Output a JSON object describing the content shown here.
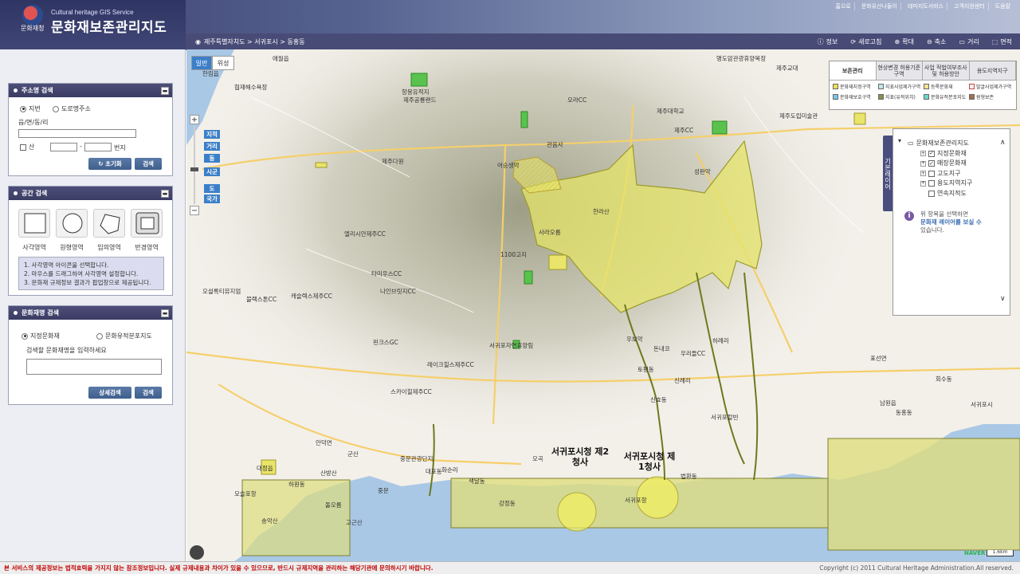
{
  "header": {
    "agency": "문화재청",
    "eng_title": "Cultural heritage GIS Service",
    "title": "문화재보존관리지도",
    "top_links": [
      "홈으로",
      "문화유산나들이",
      "테마지도서비스",
      "고객지원센터",
      "도움말"
    ]
  },
  "toolbar": {
    "breadcrumb": "제주특별자치도 > 서귀포시 > 동홍동",
    "tools": [
      {
        "label": "정보",
        "icon": "info-icon"
      },
      {
        "label": "새로고침",
        "icon": "refresh-icon"
      },
      {
        "label": "확대",
        "icon": "zoom-in-icon"
      },
      {
        "label": "축소",
        "icon": "zoom-out-icon"
      },
      {
        "label": "거리",
        "icon": "ruler-icon"
      },
      {
        "label": "면적",
        "icon": "area-icon"
      }
    ]
  },
  "address_search": {
    "title": "주소명 검색",
    "option_jibun": "지번",
    "option_road": "도로명주소",
    "field_label": "읍/면/동/리",
    "mountain_label": "산",
    "dash": "-",
    "bunji_label": "번지",
    "reset_label": "초기화",
    "search_label": "검색"
  },
  "spatial_search": {
    "title": "공간 검색",
    "shapes": [
      "사각영역",
      "원형영역",
      "임의영역",
      "반경영역"
    ],
    "instructions": [
      "1. 사각영역 아이콘을 선택합니다.",
      "2. 마우스를 드래그하여 사각영역 설정합니다.",
      "3. 문화재 규제정보 결과가 팝업창으로 제공됩니다."
    ]
  },
  "heritage_search": {
    "title": "문화재명 검색",
    "option_designated": "지정문화재",
    "option_site": "문화유적분포지도",
    "prompt": "검색할 문화재명을 입력하세요",
    "detail_label": "상세검색",
    "search_label": "검색"
  },
  "map": {
    "type_general": "일반",
    "type_satellite": "위성",
    "zoom_levels": [
      "지적",
      "거리",
      "동",
      "시군",
      "도",
      "국가"
    ],
    "big_labels": [
      {
        "text": "서귀포시청 제2청사"
      },
      {
        "text": "서귀포시청 제1청사"
      }
    ],
    "labels": [
      "애월읍",
      "항몽유적지",
      "제주공룡랜드",
      "한림읍",
      "협재해수욕장",
      "제주다원",
      "명도암관광휴양목장",
      "제주대학교",
      "제주CC",
      "오라CC",
      "제주교대",
      "제주도립미술관",
      "한라산",
      "사라오름",
      "1100고지",
      "관음사",
      "성판악",
      "어승생악",
      "오설록티뮤지엄",
      "엘리시안제주CC",
      "타미우스CC",
      "나인브릿지CC",
      "캐슬렉스제주CC",
      "블랙스톤CC",
      "핀크스GC",
      "레이크힐스제주CC",
      "스카이힐제주CC",
      "서귀포자연휴양림",
      "중문관광단지",
      "대포동",
      "강정동",
      "법환동",
      "서귀포항",
      "남원읍",
      "표선면",
      "안덕면",
      "대정읍",
      "모슬포항",
      "송악산",
      "산방산",
      "군산",
      "하례리",
      "우리들CC",
      "우보악",
      "돈내코",
      "서귀포칼빈",
      "서귀포시",
      "동홍동",
      "토평동",
      "신례리",
      "신효동",
      "돌오름",
      "오곡",
      "화순리",
      "고근산",
      "중문",
      "색달동",
      "하원동",
      "회수동"
    ],
    "legend": {
      "tabs": [
        "보존관리",
        "현상변경 허용기준구역",
        "사업 적법여부조사 및 허용방안",
        "용도지역지구"
      ],
      "items": [
        {
          "label": "문화재지정구역",
          "color": "#f2e050"
        },
        {
          "label": "지표사업제가구역",
          "color": "#bfe8e8"
        },
        {
          "label": "등록문화재",
          "color": "#f7e38c"
        },
        {
          "label": "발굴사업제가구역",
          "color": "#f2f2f2"
        },
        {
          "label": "문화재보호구역",
          "color": "#79c5f0"
        },
        {
          "label": "지표(유적위치)",
          "color": "#8a8f52"
        },
        {
          "label": "문화유적분포지도",
          "color": "#6ad8c9"
        },
        {
          "label": "원형보존",
          "color": "#a37050"
        }
      ]
    },
    "layers": {
      "tab_label": "기본레이어",
      "root": "문화재보존관리지도",
      "items": [
        {
          "label": "지정문화재",
          "checked": true
        },
        {
          "label": "매장문화재",
          "checked": true
        },
        {
          "label": "고도지구",
          "checked": false
        },
        {
          "label": "용도지역지구",
          "checked": false
        },
        {
          "label": "연속지적도",
          "checked": false
        }
      ],
      "hint_line1": "위 항목을 선택하면",
      "hint_line2": "문화재 레이어를 보실 수",
      "hint_line3": "있습니다."
    },
    "naver": "NAVER",
    "scale": "1.6km"
  },
  "footer": {
    "warning": "본 서비스의 제공정보는 법적효력을 가지지 않는 참조정보입니다. 실제 규제내용과 차이가 있을 수 있으므로, 반드시 규제지역을 관리하는 해당기관에 문의하시기 바랍니다.",
    "copyright": "Copyright (c) 2011 Cultural Heritage Administration.All reserved."
  },
  "colors": {
    "header_dark": "#3d3f6e",
    "heritage_zone": "#e6e46a",
    "sea": "#a9c8e6",
    "land": "#f3f0ea",
    "mountain": "#9a9c80"
  }
}
